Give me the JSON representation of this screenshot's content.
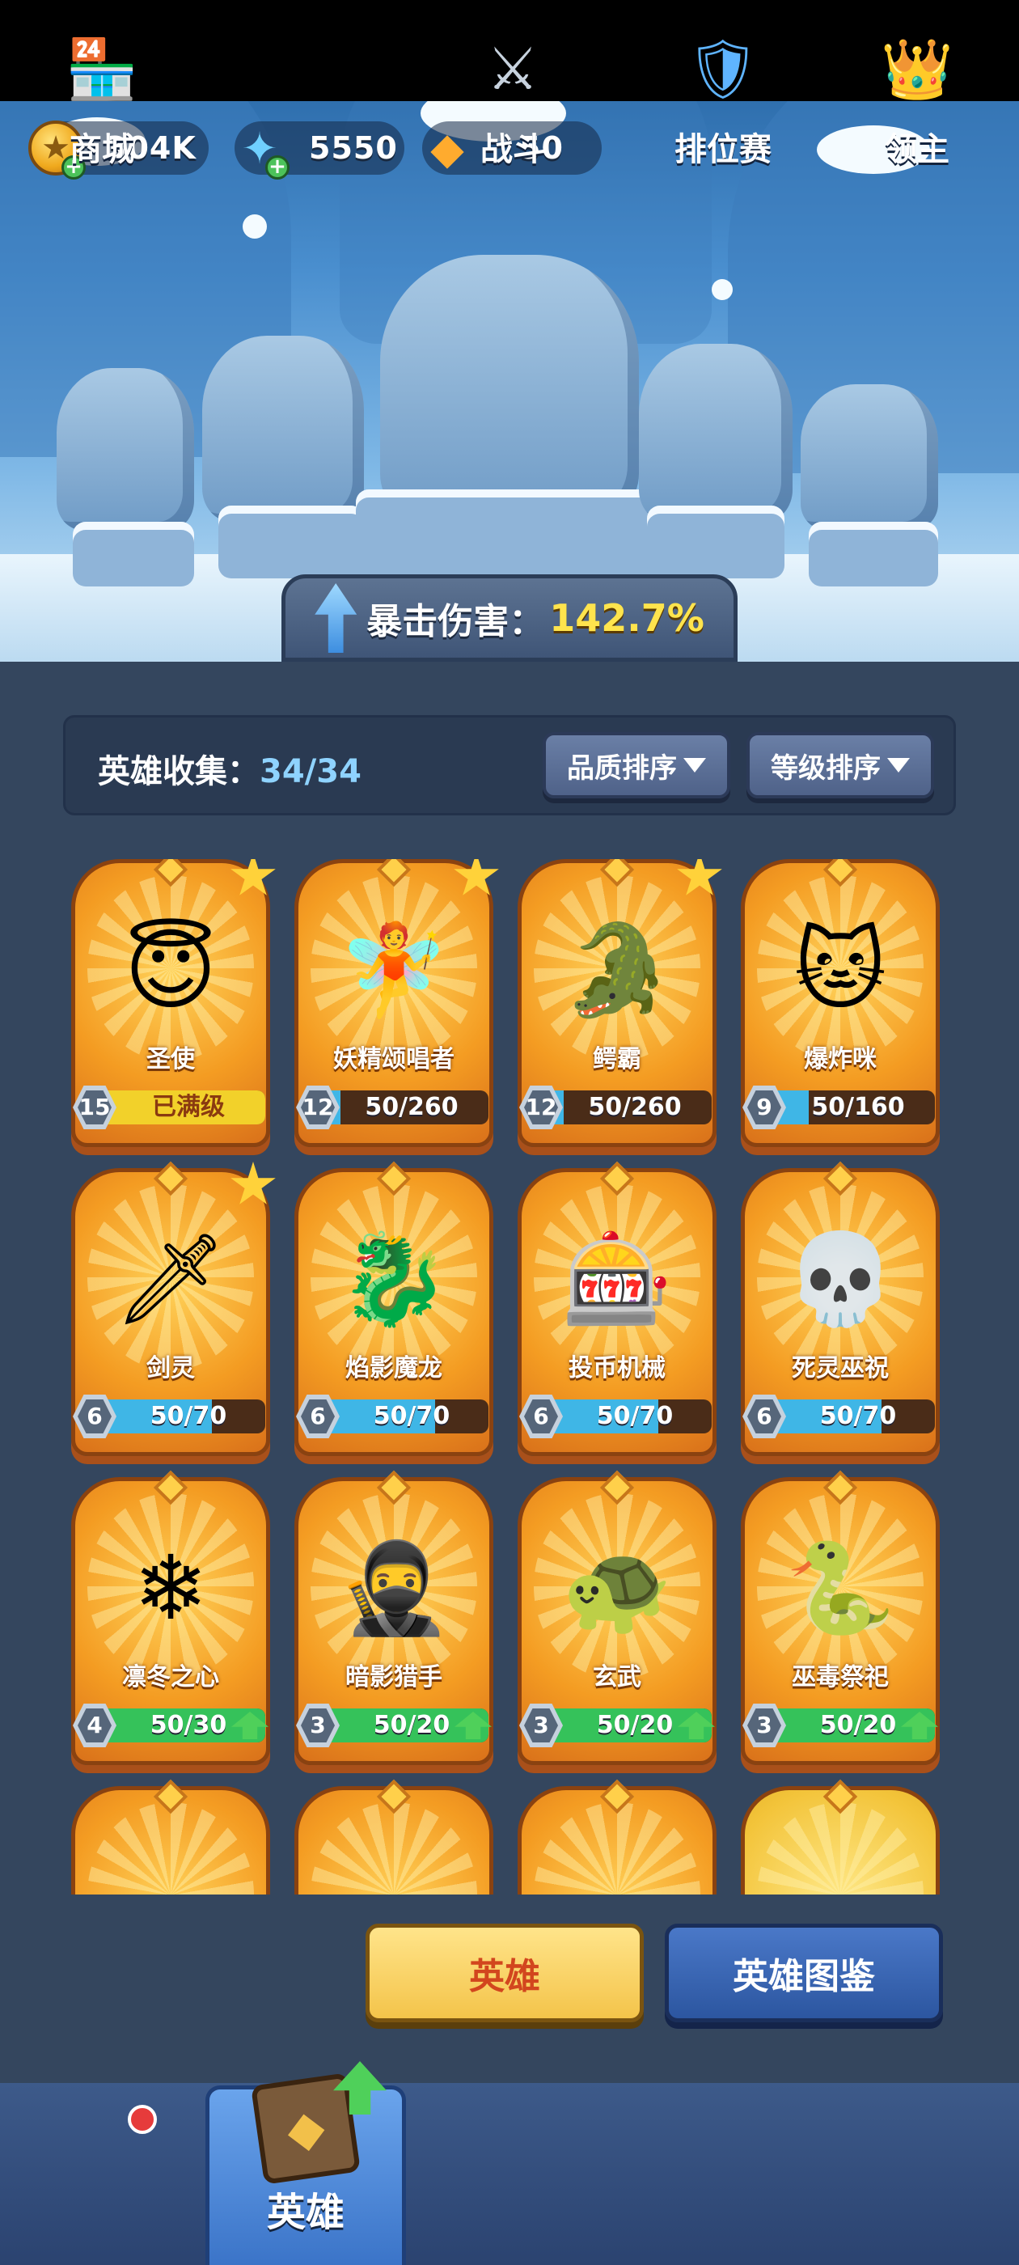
{
  "resources": [
    {
      "name": "gold",
      "value": "304K",
      "icon": "gold-coin-icon",
      "addable": true
    },
    {
      "name": "gems",
      "value": "5550",
      "icon": "blue-crystal-icon",
      "addable": true
    },
    {
      "name": "shards",
      "value": "50",
      "icon": "orange-crystal-icon",
      "addable": false
    }
  ],
  "crit": {
    "label": "暴击伤害：",
    "value": "142.7%"
  },
  "collection": {
    "label": "英雄收集：",
    "count": "34/34"
  },
  "sort": {
    "quality": "品质排序",
    "level": "等级排序"
  },
  "heroes": [
    {
      "name": "圣使",
      "level": "15",
      "progress_text": "已满级",
      "progress": 1.0,
      "bar": "yellow",
      "star": true,
      "upgrade": false
    },
    {
      "name": "妖精颂唱者",
      "level": "12",
      "progress_text": "50/260",
      "progress": 0.19,
      "bar": "blue",
      "star": true,
      "upgrade": false
    },
    {
      "name": "鳄霸",
      "level": "12",
      "progress_text": "50/260",
      "progress": 0.19,
      "bar": "blue",
      "star": true,
      "upgrade": false
    },
    {
      "name": "爆炸咪",
      "level": "9",
      "progress_text": "50/160",
      "progress": 0.31,
      "bar": "blue",
      "star": false,
      "upgrade": false
    },
    {
      "name": "剑灵",
      "level": "6",
      "progress_text": "50/70",
      "progress": 0.71,
      "bar": "blue",
      "star": true,
      "upgrade": false
    },
    {
      "name": "焰影魔龙",
      "level": "6",
      "progress_text": "50/70",
      "progress": 0.71,
      "bar": "blue",
      "star": false,
      "upgrade": false
    },
    {
      "name": "投币机械",
      "level": "6",
      "progress_text": "50/70",
      "progress": 0.71,
      "bar": "blue",
      "star": false,
      "upgrade": false
    },
    {
      "name": "死灵巫祝",
      "level": "6",
      "progress_text": "50/70",
      "progress": 0.71,
      "bar": "blue",
      "star": false,
      "upgrade": false
    },
    {
      "name": "凛冬之心",
      "level": "4",
      "progress_text": "50/30",
      "progress": 1.0,
      "bar": "green",
      "star": false,
      "upgrade": true
    },
    {
      "name": "暗影猎手",
      "level": "3",
      "progress_text": "50/20",
      "progress": 1.0,
      "bar": "green",
      "star": false,
      "upgrade": true
    },
    {
      "name": "玄武",
      "level": "3",
      "progress_text": "50/20",
      "progress": 1.0,
      "bar": "green",
      "star": false,
      "upgrade": true
    },
    {
      "name": "巫毒祭祀",
      "level": "3",
      "progress_text": "50/20",
      "progress": 1.0,
      "bar": "green",
      "star": false,
      "upgrade": true
    }
  ],
  "buttons": {
    "hero": "英雄",
    "codex": "英雄图鉴"
  },
  "nav": [
    {
      "label": "商城",
      "icon": "shop-icon",
      "active": false
    },
    {
      "label": "英雄",
      "icon": "hero-card-icon",
      "active": true
    },
    {
      "label": "战斗",
      "icon": "crossed-swords-icon",
      "active": false
    },
    {
      "label": "排位赛",
      "icon": "rank-shield-icon",
      "active": false
    },
    {
      "label": "领主",
      "icon": "lord-banner-icon",
      "active": false
    }
  ],
  "colors": {
    "bar_yellow": "#f2d12a",
    "bar_blue": "#3fb6e6",
    "bar_green": "#35c25a",
    "accent_crit": "#ffe44d"
  }
}
